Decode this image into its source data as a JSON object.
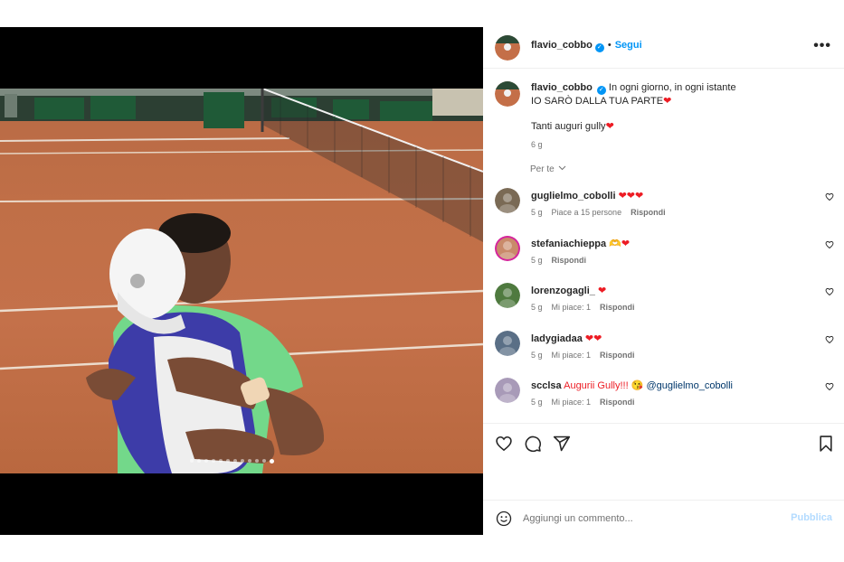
{
  "post": {
    "username": "flavio_cobbo",
    "follow_label": "Segui",
    "more_label": "•••",
    "separator": "•",
    "verified_mark": "✓"
  },
  "caption": {
    "username": "flavio_cobbo",
    "line1": "In ogni giorno, in ogni istante",
    "line2": "IO SARÒ DALLA TUA PARTE",
    "line3": "Tanti auguri gully",
    "heart": "❤",
    "age": "6 g"
  },
  "for_you_label": "Per te",
  "comments": [
    {
      "username": "guglielmo_cobolli",
      "text": "❤❤❤",
      "age": "5 g",
      "likes": "Piace a 15 persone",
      "reply": "Rispondi",
      "avatar_color": "#7a6a55"
    },
    {
      "username": "stefaniachieppa",
      "text": "🫶❤",
      "age": "5 g",
      "likes": "",
      "reply": "Rispondi",
      "avatar_color": "#c98a6a"
    },
    {
      "username": "lorenzogagli_",
      "text": "❤",
      "age": "5 g",
      "likes": "Mi piace: 1",
      "reply": "Rispondi",
      "avatar_color": "#4f7a3f"
    },
    {
      "username": "ladygiadaa",
      "text": "❤❤",
      "age": "5 g",
      "likes": "Mi piace: 1",
      "reply": "Rispondi",
      "avatar_color": "#5a6f86"
    },
    {
      "username": "scclsa",
      "text": "Augurii Gully!!! 😘",
      "mention": "@guglielmo_cobolli",
      "age": "5 g",
      "likes": "Mi piace: 1",
      "reply": "Rispondi",
      "avatar_color": "#a89ab8"
    }
  ],
  "composer": {
    "placeholder": "Aggiungi un commento...",
    "publish_label": "Pubblica"
  },
  "carousel": {
    "total": 12,
    "active_index": 11
  },
  "icons": {
    "heart": "heart-icon",
    "comment": "comment-icon",
    "share": "share-icon",
    "save": "bookmark-icon",
    "emoji": "emoji-icon",
    "more": "more-icon"
  },
  "colors": {
    "accent": "#0095f6",
    "heart_red": "#ed1c24",
    "muted": "#737373",
    "publish_disabled": "#b3dbff"
  }
}
